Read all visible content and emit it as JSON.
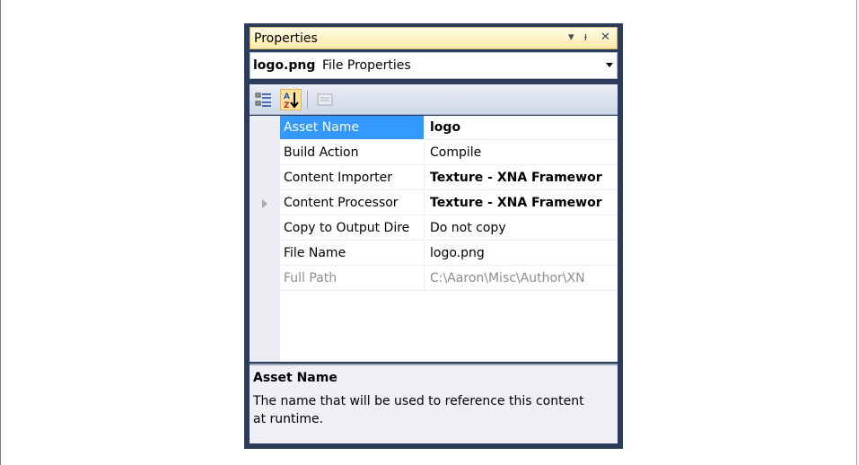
{
  "panel": {
    "title": "Properties",
    "icons": [
      "dropdown-arrow-icon",
      "pin-icon",
      "close-icon"
    ]
  },
  "object_selector": {
    "name": "logo.png",
    "type": "File Properties"
  },
  "toolbar": {
    "buttons": [
      "categorized-icon",
      "alphabetical-sort-icon",
      "property-pages-icon"
    ]
  },
  "properties": [
    {
      "name": "Asset Name",
      "value": "logo"
    },
    {
      "name": "Build Action",
      "value": "Compile"
    },
    {
      "name": "Content Importer",
      "value": "Texture - XNA Framewor"
    },
    {
      "name": "Content Processor",
      "value": "Texture - XNA Framewor"
    },
    {
      "name": "Copy to Output Dire",
      "value": "Do not copy"
    },
    {
      "name": "File Name",
      "value": "logo.png"
    },
    {
      "name": "Full Path",
      "value": "C:\\Aaron\\Misc\\Author\\XN"
    }
  ],
  "description": {
    "title": "Asset Name",
    "text": "The name that will be used to reference this content at runtime."
  },
  "colors": {
    "selection": "#3399ff",
    "window_frame": "#2c3d5c",
    "title_bar": "#fde9a6"
  }
}
